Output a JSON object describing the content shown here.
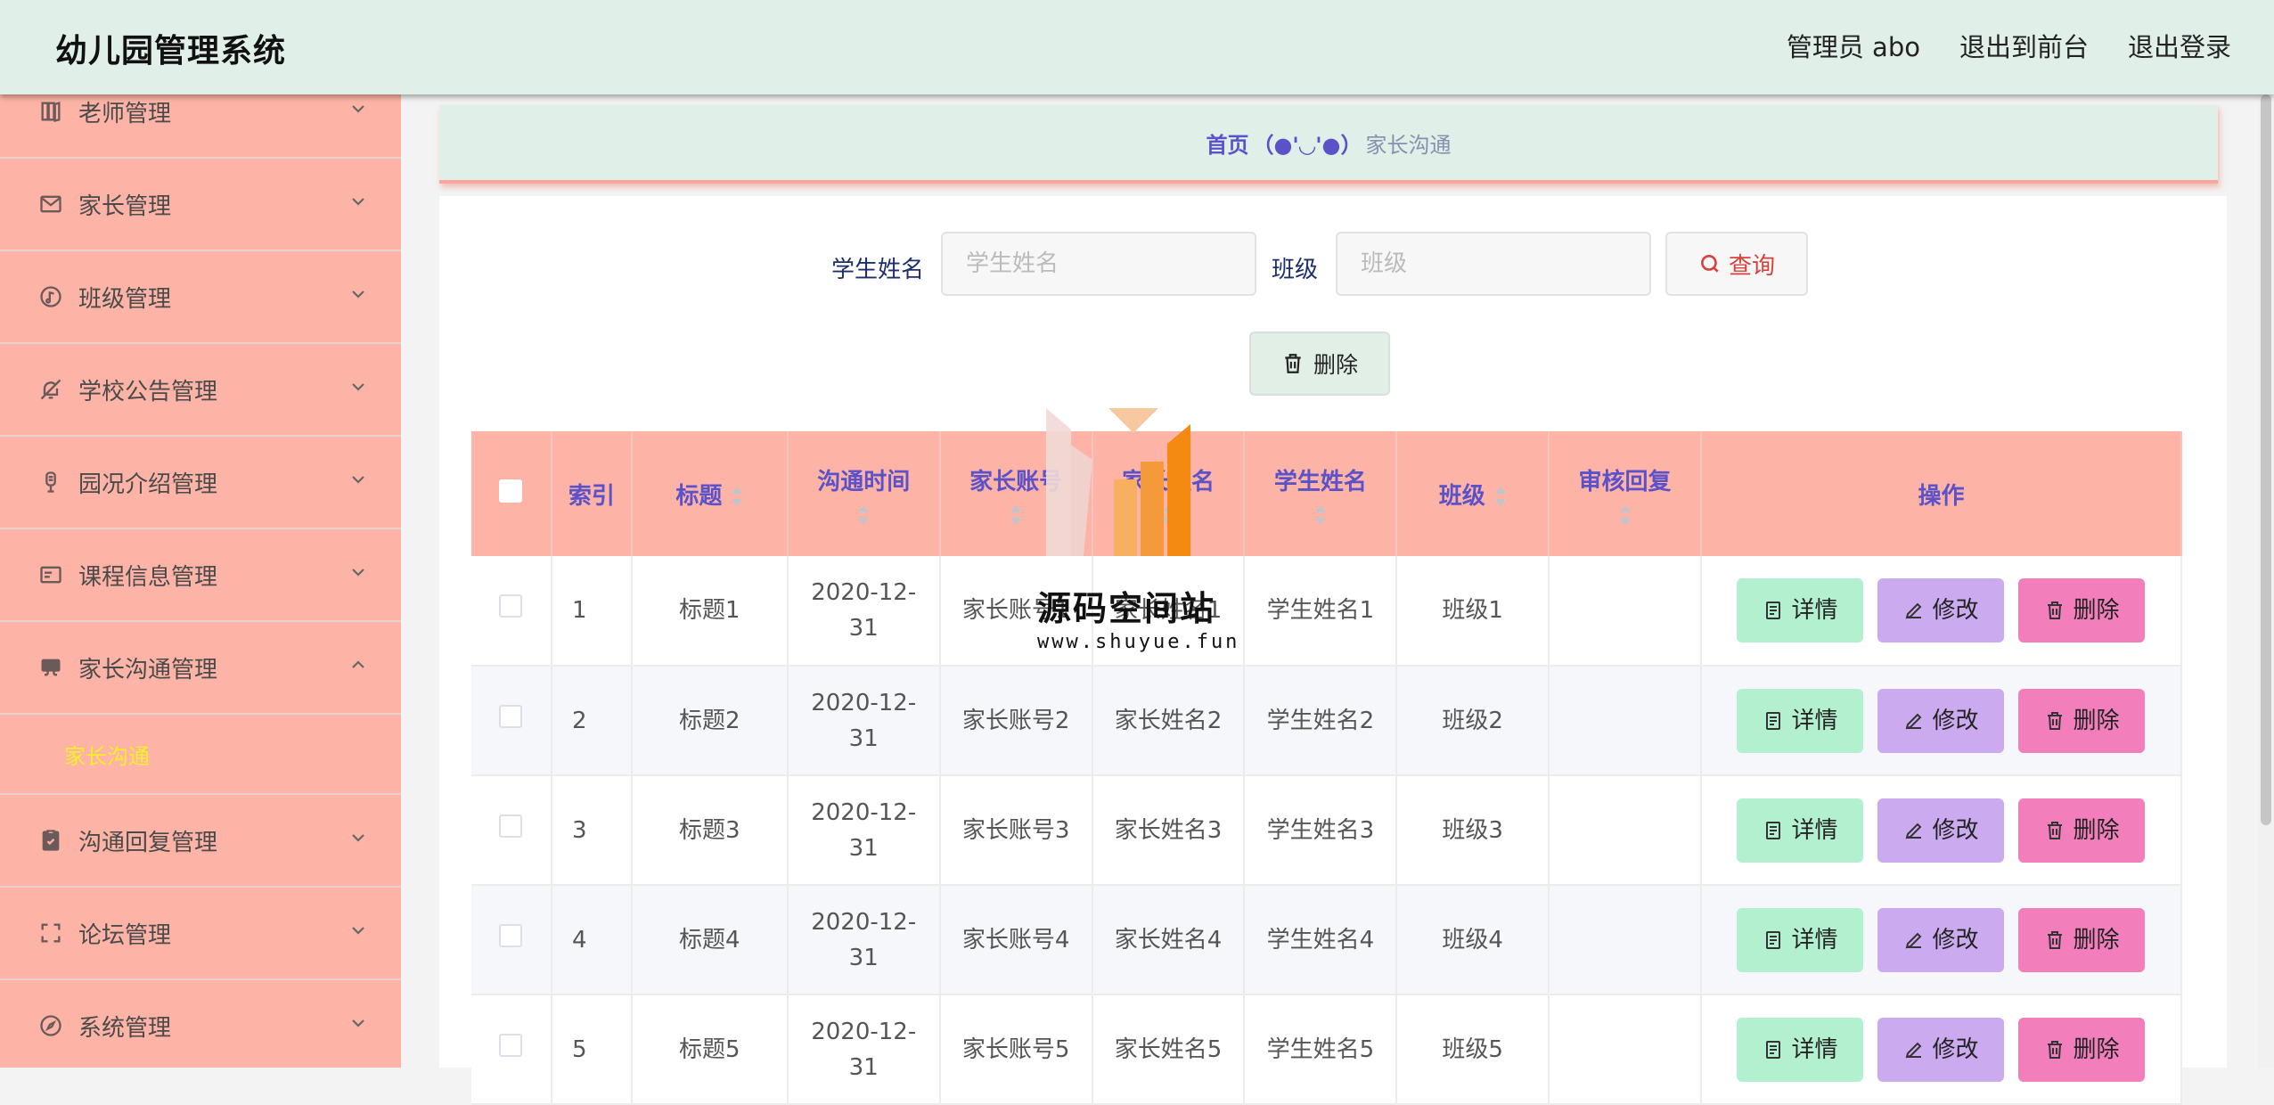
{
  "header": {
    "title": "幼儿园管理系统",
    "user": "管理员 abo",
    "to_front": "退出到前台",
    "logout": "退出登录"
  },
  "sidebar": {
    "items": [
      {
        "label": "老师管理",
        "icon": "book-icon"
      },
      {
        "label": "家长管理",
        "icon": "mail-icon"
      },
      {
        "label": "班级管理",
        "icon": "music-icon"
      },
      {
        "label": "学校公告管理",
        "icon": "bell-off-icon"
      },
      {
        "label": "园况介绍管理",
        "icon": "microphone-icon"
      },
      {
        "label": "课程信息管理",
        "icon": "postcard-icon"
      },
      {
        "label": "家长沟通管理",
        "icon": "monitor-icon",
        "expanded": true
      },
      {
        "label": "沟通回复管理",
        "icon": "clipboard-icon"
      },
      {
        "label": "论坛管理",
        "icon": "fullscreen-icon"
      },
      {
        "label": "系统管理",
        "icon": "compass-icon"
      }
    ],
    "sub_active": "家长沟通"
  },
  "breadcrumb": {
    "home": "首页",
    "separator": "（●'◡'●）",
    "current": "家长沟通"
  },
  "search": {
    "student_label": "学生姓名",
    "student_placeholder": "学生姓名",
    "class_label": "班级",
    "class_placeholder": "班级",
    "query_button": "查询"
  },
  "toolbar": {
    "delete_button": "删除"
  },
  "table": {
    "columns": [
      "索引",
      "标题",
      "沟通时间",
      "家长账号",
      "家长姓名",
      "学生姓名",
      "班级",
      "审核回复",
      "操作"
    ],
    "rows": [
      {
        "index": "1",
        "title": "标题1",
        "time": "2020-12-31",
        "account": "家长账号1",
        "parent": "家长姓名1",
        "student": "学生姓名1",
        "class": "班级1",
        "reply": ""
      },
      {
        "index": "2",
        "title": "标题2",
        "time": "2020-12-31",
        "account": "家长账号2",
        "parent": "家长姓名2",
        "student": "学生姓名2",
        "class": "班级2",
        "reply": ""
      },
      {
        "index": "3",
        "title": "标题3",
        "time": "2020-12-31",
        "account": "家长账号3",
        "parent": "家长姓名3",
        "student": "学生姓名3",
        "class": "班级3",
        "reply": ""
      },
      {
        "index": "4",
        "title": "标题4",
        "time": "2020-12-31",
        "account": "家长账号4",
        "parent": "家长姓名4",
        "student": "学生姓名4",
        "class": "班级4",
        "reply": ""
      },
      {
        "index": "5",
        "title": "标题5",
        "time": "2020-12-31",
        "account": "家长账号5",
        "parent": "家长姓名5",
        "student": "学生姓名5",
        "class": "班级5",
        "reply": ""
      }
    ],
    "actions": {
      "detail": "详情",
      "edit": "修改",
      "delete": "删除"
    }
  },
  "watermark": {
    "name": "源码空间站",
    "url": "www.shuyue.fun"
  },
  "colors": {
    "header_bg": "#e0efe8",
    "sidebar_bg": "#fdb3a6",
    "accent": "#5b51c9",
    "active_sub": "#f7ef2a"
  }
}
